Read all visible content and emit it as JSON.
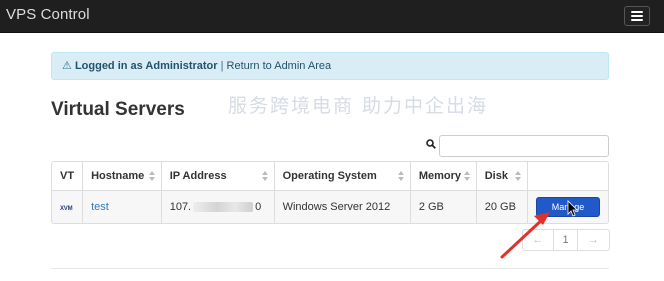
{
  "app": {
    "title": "VPS Control"
  },
  "alert": {
    "logged_in": "Logged in as Administrator",
    "separator": " | ",
    "return_link": "Return to Admin Area"
  },
  "page_title": "Virtual Servers",
  "search": {
    "value": "",
    "placeholder": ""
  },
  "table": {
    "columns": [
      "VT",
      "Hostname",
      "IP Address",
      "Operating System",
      "Memory",
      "Disk",
      ""
    ],
    "rows": [
      {
        "vt": "XVM",
        "hostname": "test",
        "ip_prefix": "107.",
        "ip_suffix": "0",
        "os": "Windows Server 2012",
        "memory": "2 GB",
        "disk": "20 GB",
        "action": "Manage"
      }
    ]
  },
  "pagination": {
    "prev": "←",
    "current": "1",
    "next": "→"
  },
  "watermark": {
    "text": "服务跨境电商 助力中企出海"
  },
  "colors": {
    "navbar": "#1f1f1f",
    "alert_bg": "#d9edf7",
    "link": "#337ab7",
    "manage_button": "#2159c9",
    "annotation_arrow": "#e0312b"
  }
}
